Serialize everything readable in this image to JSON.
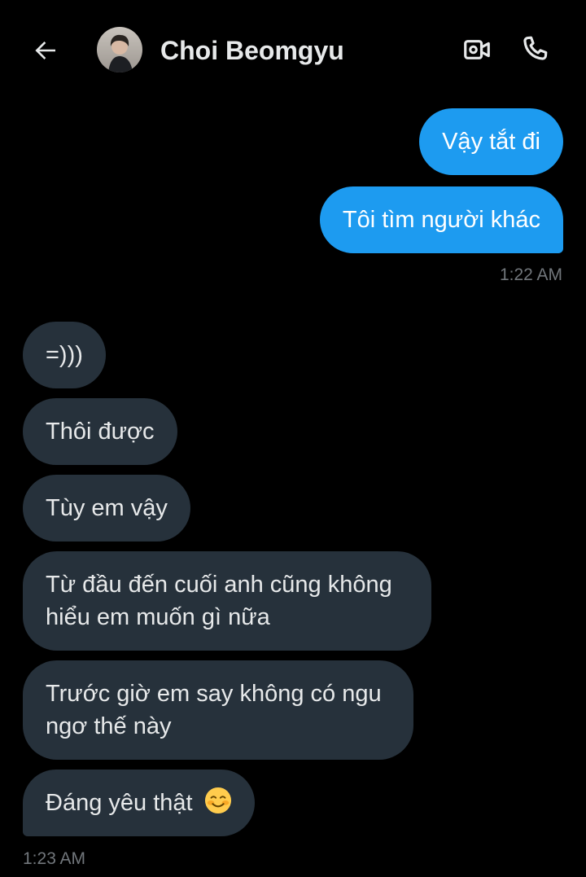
{
  "header": {
    "contact_name": "Choi Beomgyu"
  },
  "conversation": {
    "sent_group": {
      "messages": [
        "Vậy tắt đi",
        "Tôi tìm người khác"
      ],
      "timestamp": "1:22 AM"
    },
    "received_group": {
      "messages": [
        "=)))",
        "Thôi được",
        "Tùy em vậy",
        "Từ đầu đến cuối anh cũng không hiểu em muốn gì nữa",
        "Trước giờ em say không có ngu ngơ thế này",
        "Đáng yêu thật"
      ],
      "last_message_emoji": "smiling-face-with-blush",
      "timestamp": "1:23 AM"
    }
  },
  "colors": {
    "background": "#000000",
    "sent_bubble": "#1d9bf0",
    "received_bubble": "#26313b",
    "timestamp": "#71767b"
  },
  "icons": [
    "back-arrow-icon",
    "video-camera-icon",
    "phone-icon"
  ]
}
